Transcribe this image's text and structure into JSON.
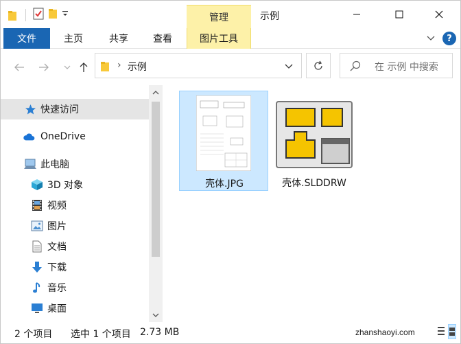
{
  "window": {
    "title": "示例",
    "context_tab_group": "管理"
  },
  "ribbon": {
    "tabs": [
      "文件",
      "主页",
      "共享",
      "查看",
      "图片工具"
    ]
  },
  "address": {
    "crumb": "示例",
    "search_placeholder": "在 示例 中搜索"
  },
  "nav": {
    "items": [
      {
        "label": "快速访问",
        "icon": "star-icon"
      },
      {
        "label": "OneDrive",
        "icon": "cloud-icon"
      },
      {
        "label": "此电脑",
        "icon": "computer-icon"
      },
      {
        "label": "3D 对象",
        "icon": "cube-icon"
      },
      {
        "label": "视频",
        "icon": "film-icon"
      },
      {
        "label": "图片",
        "icon": "picture-icon"
      },
      {
        "label": "文档",
        "icon": "document-icon"
      },
      {
        "label": "下载",
        "icon": "download-icon"
      },
      {
        "label": "音乐",
        "icon": "music-icon"
      },
      {
        "label": "桌面",
        "icon": "desktop-icon"
      }
    ]
  },
  "files": [
    {
      "name": "壳体.JPG",
      "selected": true
    },
    {
      "name": "壳体.SLDDRW",
      "selected": false
    }
  ],
  "status": {
    "count": "2 个项目",
    "selection": "选中 1 个项目",
    "size": "2.73 MB",
    "watermark": "zhanshaoyi.com"
  },
  "colors": {
    "accent": "#1a66b3",
    "context_tab": "#fdf1a8",
    "selection": "#cce8ff"
  }
}
